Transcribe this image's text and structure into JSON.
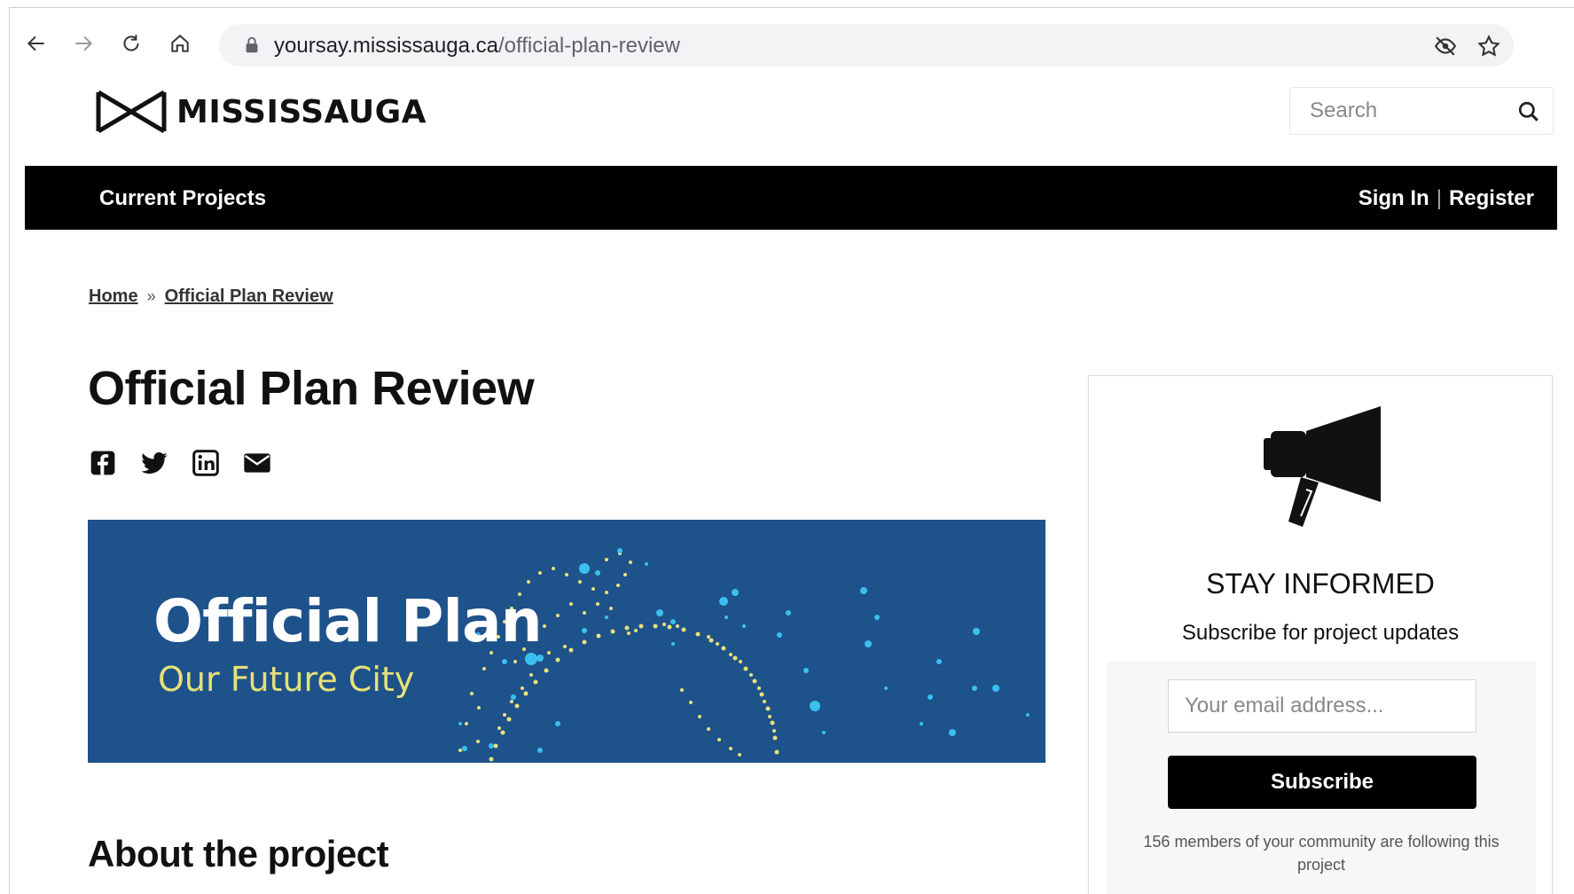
{
  "browser": {
    "url_host": "yoursay.mississauga.ca",
    "url_path": "/official-plan-review",
    "icons": [
      "back-icon",
      "forward-icon",
      "reload-icon",
      "home-icon",
      "lock-icon",
      "eye-off-icon",
      "star-icon"
    ]
  },
  "header": {
    "logo_text": "MISSISSAUGA",
    "search_placeholder": "Search"
  },
  "navbar": {
    "projects_label": "Current Projects",
    "sign_in_label": "Sign In",
    "separator": "|",
    "register_label": "Register"
  },
  "breadcrumb": {
    "home": "Home",
    "separator": "»",
    "current": "Official Plan Review"
  },
  "main": {
    "title": "Official Plan Review",
    "share_icons": [
      "facebook-icon",
      "twitter-icon",
      "linkedin-icon",
      "email-icon"
    ],
    "banner": {
      "title": "Official Plan",
      "subtitle": "Our Future City",
      "background": "#1e528a",
      "subtitle_color": "#e6e07a"
    },
    "about_heading": "About the project"
  },
  "sidebar": {
    "heading": "STAY INFORMED",
    "subheading": "Subscribe for project updates",
    "email_placeholder": "Your email address...",
    "subscribe_label": "Subscribe",
    "followers_text": "156 members of your community are following this project"
  }
}
